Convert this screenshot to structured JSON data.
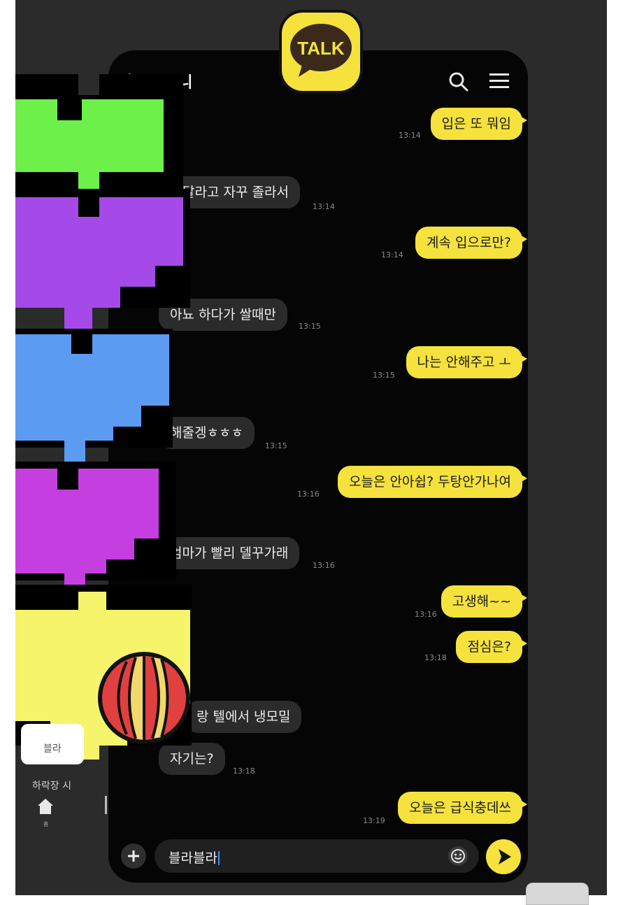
{
  "chat": {
    "title": "지니",
    "back_icon": "arrow-left-icon",
    "search_icon": "search-icon",
    "menu_icon": "hamburger-menu-icon"
  },
  "logo": {
    "text": "TALK",
    "color": "#f5e23c"
  },
  "messages": [
    {
      "text": "입은 또 뭐임",
      "time": "13:14",
      "from": "me"
    },
    {
      "text": "달라고 자꾸 졸라서",
      "time": "13:14",
      "from": "them"
    },
    {
      "text": "계속 입으로만?",
      "time": "13:14",
      "from": "me"
    },
    {
      "text": "아뇨 하다가 쌀때만",
      "time": "13:15",
      "from": "them"
    },
    {
      "text": "나는 안해주고 ㅗ",
      "time": "13:15",
      "from": "me"
    },
    {
      "text": "해줄겡ㅎㅎㅎ",
      "time": "13:15",
      "from": "them"
    },
    {
      "text": "오늘은 안아쉽? 두탕안가나여",
      "time": "13:16",
      "from": "me"
    },
    {
      "text": "엄마가 빨리 델꾸가래",
      "time": "13:16",
      "from": "them"
    },
    {
      "text": "고생해~~",
      "time": "13:16",
      "from": "me"
    },
    {
      "text": "점심은?",
      "time": "13:18",
      "from": "me"
    },
    {
      "text": "랑 텔에서 냉모밀",
      "time": "",
      "from": "them"
    },
    {
      "text": "자기는?",
      "time": "13:18",
      "from": "them"
    },
    {
      "text": "오늘은 급식충데쓰",
      "time": "13:19",
      "from": "me"
    }
  ],
  "input": {
    "value": "블라블라"
  },
  "left_panel": {
    "card_label": "블라",
    "caption": "하락장 시",
    "home_label": "홈"
  },
  "colors": {
    "bubble_me": "#f5e23c",
    "bubble_them": "#2b2b2b",
    "background": "#050505"
  },
  "hearts": [
    {
      "color": "#6ef04a"
    },
    {
      "color": "#a54ae8"
    },
    {
      "color": "#5b9cf2"
    },
    {
      "color": "#c53fe0"
    },
    {
      "color": "#f6f46a"
    }
  ]
}
